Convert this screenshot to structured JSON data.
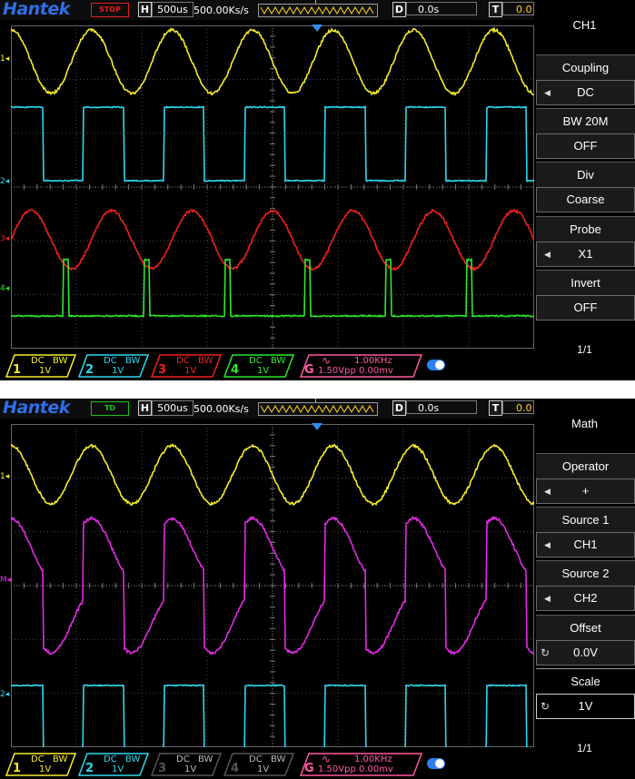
{
  "colors": {
    "ch1": "#f5ec2c",
    "ch2": "#2fd8ef",
    "ch3": "#f22020",
    "ch4": "#2ee82e",
    "math": "#e62ae6",
    "gen": "#ff5aa0",
    "brand": "#2f6fe8",
    "grid": "#4a4a4a"
  },
  "screens": [
    {
      "logo": "Hantek",
      "status": "STOP",
      "h_label": "H",
      "timebase": "500us",
      "sample_rate": "500.00Ks/s",
      "trigger_marker": "T",
      "d_label": "D",
      "delay": "0.0s",
      "t_label": "T",
      "trigger_level": "0.0",
      "channel_markers": [
        {
          "label": "1",
          "color": "#f5ec2c"
        },
        {
          "label": "2",
          "color": "#2fd8ef"
        },
        {
          "label": "3",
          "color": "#f22020"
        },
        {
          "label": "4",
          "color": "#2ee82e"
        }
      ],
      "menu": {
        "title": "CH1",
        "items": [
          {
            "label": "Coupling",
            "value": "DC"
          },
          {
            "label": "BW 20M",
            "value": "OFF"
          },
          {
            "label": "Div",
            "value": "Coarse"
          },
          {
            "label": "Probe",
            "value": "X1"
          },
          {
            "label": "Invert",
            "value": "OFF"
          }
        ],
        "page": "1/1"
      },
      "channels": [
        {
          "num": "1",
          "coupling": "DC",
          "bw": "BW",
          "vdiv": "1V",
          "color": "#f5ec2c",
          "text_color": "#f5ec2c"
        },
        {
          "num": "2",
          "coupling": "DC",
          "bw": "BW",
          "vdiv": "1V",
          "color": "#2fd8ef",
          "text_color": "#2fd8ef"
        },
        {
          "num": "3",
          "coupling": "DC",
          "bw": "BW",
          "vdiv": "1V",
          "color": "#f22020",
          "text_color": "#f22020"
        },
        {
          "num": "4",
          "coupling": "DC",
          "bw": "BW",
          "vdiv": "1V",
          "color": "#2ee82e",
          "text_color": "#2ee82e"
        }
      ],
      "generator": {
        "label": "G",
        "wave_icon": "sine-wave-icon",
        "frequency": "1.00KHz",
        "amplitude": "1.50Vpp 0.00mv"
      }
    },
    {
      "logo": "Hantek",
      "status": "TD",
      "h_label": "H",
      "timebase": "500us",
      "sample_rate": "500.00Ks/s",
      "trigger_marker": "T",
      "d_label": "D",
      "delay": "0.0s",
      "t_label": "T",
      "trigger_level": "0.0",
      "channel_markers": [
        {
          "label": "1",
          "color": "#f5ec2c"
        },
        {
          "label": "M",
          "color": "#e62ae6"
        },
        {
          "label": "2",
          "color": "#2fd8ef"
        }
      ],
      "menu": {
        "title": "Math",
        "items": [
          {
            "label": "Operator",
            "value": "+"
          },
          {
            "label": "Source 1",
            "value": "CH1"
          },
          {
            "label": "Source 2",
            "value": "CH2"
          },
          {
            "label": "Offset",
            "value": "0.0V"
          },
          {
            "label": "Scale",
            "value": "1V"
          }
        ],
        "page": "1/1"
      },
      "channels": [
        {
          "num": "1",
          "coupling": "DC",
          "bw": "BW",
          "vdiv": "1V",
          "color": "#f5ec2c",
          "text_color": "#f5ec2c"
        },
        {
          "num": "2",
          "coupling": "DC",
          "bw": "BW",
          "vdiv": "1V",
          "color": "#2fd8ef",
          "text_color": "#2fd8ef"
        },
        {
          "num": "3",
          "coupling": "DC",
          "bw": "BW",
          "vdiv": "1V",
          "color": "#555555",
          "text_color": "#bbbbbb"
        },
        {
          "num": "4",
          "coupling": "DC",
          "bw": "BW",
          "vdiv": "1V",
          "color": "#555555",
          "text_color": "#bbbbbb"
        }
      ],
      "generator": {
        "label": "G",
        "wave_icon": "sine-wave-icon",
        "frequency": "1.00KHz",
        "amplitude": "1.50Vpp 0.00mv"
      }
    }
  ]
}
